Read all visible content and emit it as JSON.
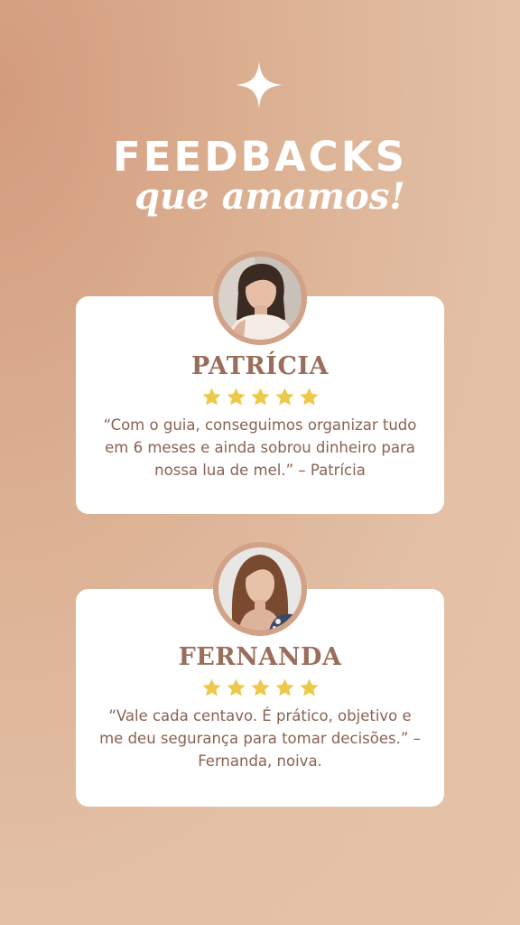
{
  "header": {
    "title": "FEEDBACKS",
    "subtitle": "que amamos!",
    "icon": "sparkle-icon"
  },
  "testimonials": [
    {
      "name": "PATRÍCIA",
      "rating": 5,
      "quote": "“Com o guia, conseguimos organizar tudo em 6 meses e ainda sobrou dinheiro para nossa lua de mel.” – Patrícia"
    },
    {
      "name": "FERNANDA",
      "rating": 5,
      "quote": "“Vale cada centavo. É prático, objetivo e me deu segurança para tomar decisões.” – Fernanda, noiva."
    }
  ],
  "colors": {
    "background": "#e3c0a6",
    "accent": "#9a6e5c",
    "star": "#ecc94b",
    "ring": "#d1a287"
  }
}
